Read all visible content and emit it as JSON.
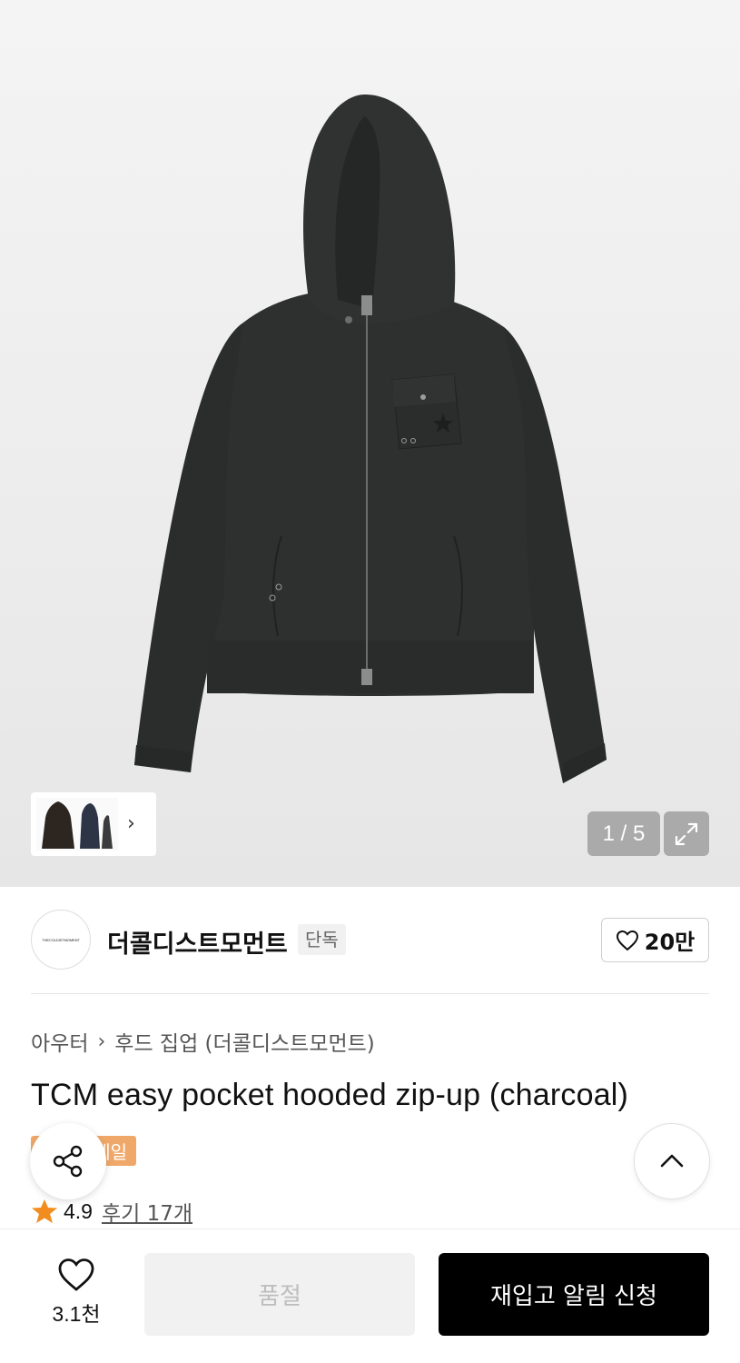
{
  "gallery": {
    "counter": "1 / 5",
    "expand_icon": "expand-icon",
    "thumb_next_icon": "chevron-right-icon"
  },
  "brand": {
    "logo_text": "THECOLDISTMOMENT",
    "name": "더콜디스트모먼트",
    "tag": "단독",
    "likes": "20만"
  },
  "breadcrumb": {
    "category": "아우터",
    "subcategory": "후드 집업 (더콜디스트모먼트)"
  },
  "product": {
    "title": "TCM easy pocket hooded zip-up (charcoal)",
    "badge": "세일",
    "rating": "4.9",
    "reviews": "후기 17개"
  },
  "bottom_bar": {
    "wish_count": "3.1천",
    "soldout_label": "품절",
    "restock_label": "재입고 알림 신청"
  },
  "colors": {
    "accent_star": "#f28c1e",
    "sale_badge": "#f0a86a",
    "garment": "#2d302f"
  }
}
